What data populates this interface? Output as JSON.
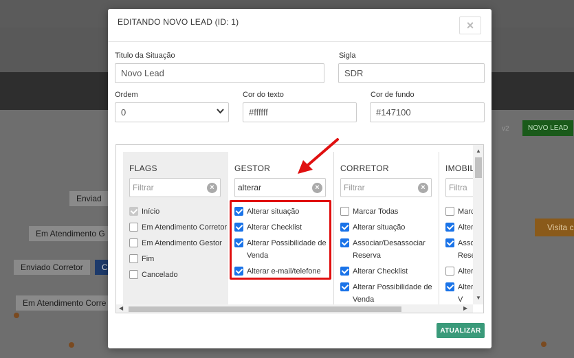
{
  "background": {
    "nodes": [
      {
        "label": "Enviad"
      },
      {
        "label": "Em Atendimento G"
      },
      {
        "label": "Enviado Corretor"
      },
      {
        "label": "C"
      },
      {
        "label": "Em Atendimento Corre"
      },
      {
        "label": "NOVO LEAD"
      },
      {
        "label": "Visita c"
      }
    ],
    "version": "v2"
  },
  "modal": {
    "title": "EDITANDO NOVO LEAD (ID: 1)",
    "close_icon": "×",
    "fields": {
      "titulo": {
        "label": "Titulo da Situação",
        "value": "Novo Lead"
      },
      "sigla": {
        "label": "Sigla",
        "value": "SDR"
      },
      "ordem": {
        "label": "Ordem",
        "value": "0"
      },
      "cor_texto": {
        "label": "Cor do texto",
        "value": "#ffffff"
      },
      "cor_fundo": {
        "label": "Cor de fundo",
        "value": "#147100"
      }
    },
    "columns": {
      "flags": {
        "title": "FLAGS",
        "filter_placeholder": "Filtrar",
        "filter_value": "",
        "items": [
          {
            "label": "Início",
            "state": "disabled-checked"
          },
          {
            "label": "Em Atendimento Corretor",
            "state": "off"
          },
          {
            "label": "Em Atendimento Gestor",
            "state": "off"
          },
          {
            "label": "Fim",
            "state": "off"
          },
          {
            "label": "Cancelado",
            "state": "off"
          }
        ]
      },
      "gestor": {
        "title": "GESTOR",
        "filter_placeholder": "Filtrar",
        "filter_value": "alterar",
        "items": [
          {
            "label": "Alterar situação",
            "state": "checked"
          },
          {
            "label": "Alterar Checklist",
            "state": "checked"
          },
          {
            "label": "Alterar Possibilidade de Venda",
            "state": "checked"
          },
          {
            "label": "Alterar e-mail/telefone",
            "state": "checked"
          }
        ]
      },
      "corretor": {
        "title": "CORRETOR",
        "filter_placeholder": "Filtrar",
        "filter_value": "",
        "items": [
          {
            "label": "Marcar Todas",
            "state": "off"
          },
          {
            "label": "Alterar situação",
            "state": "checked"
          },
          {
            "label": "Associar/Desassociar Reserva",
            "state": "checked"
          },
          {
            "label": "Alterar Checklist",
            "state": "checked"
          },
          {
            "label": "Alterar Possibilidade de Venda",
            "state": "checked"
          }
        ]
      },
      "imobiliaria": {
        "title": "IMOBILI",
        "filter_placeholder": "Filtra",
        "filter_value": "",
        "items": [
          {
            "label": "Marc",
            "state": "off"
          },
          {
            "label": "Alter",
            "state": "checked"
          },
          {
            "label": "Asso Rese",
            "state": "checked"
          },
          {
            "label": "Alter",
            "state": "off"
          },
          {
            "label": "Alter de V",
            "state": "checked"
          }
        ]
      }
    },
    "update_label": "ATUALIZAR",
    "colors": {
      "update": "#3a9a7a",
      "checkbox": "#1a73e8",
      "highlight": "#e01010"
    }
  }
}
